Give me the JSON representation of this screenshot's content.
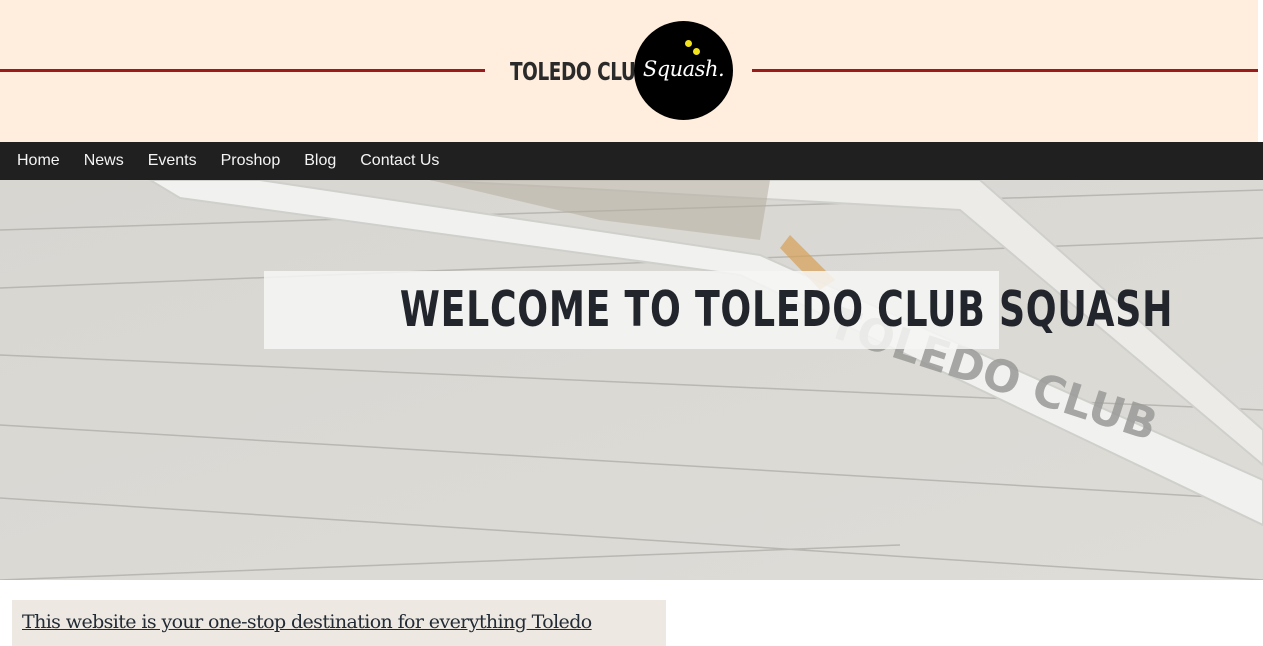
{
  "header": {
    "brand_text": "TOLEDO CLUB",
    "logo_script": "Squash.",
    "colors": {
      "background": "#ffeedd",
      "rule": "#9b1b1b",
      "logo_circle": "#000000",
      "ball": "#f2e31a"
    }
  },
  "nav": {
    "items": [
      {
        "label": "Home"
      },
      {
        "label": "News"
      },
      {
        "label": "Events"
      },
      {
        "label": "Proshop"
      },
      {
        "label": "Blog"
      },
      {
        "label": "Contact Us"
      }
    ],
    "colors": {
      "background": "#202020",
      "text": "#f4f4f4"
    }
  },
  "hero": {
    "title": "WELCOME TO TOLEDO CLUB SQUASH",
    "racket_text": "TOLEDO CLUB",
    "colors": {
      "title": "#22252b"
    }
  },
  "intro": {
    "text": "This website is your one-stop destination for everything Toledo"
  }
}
